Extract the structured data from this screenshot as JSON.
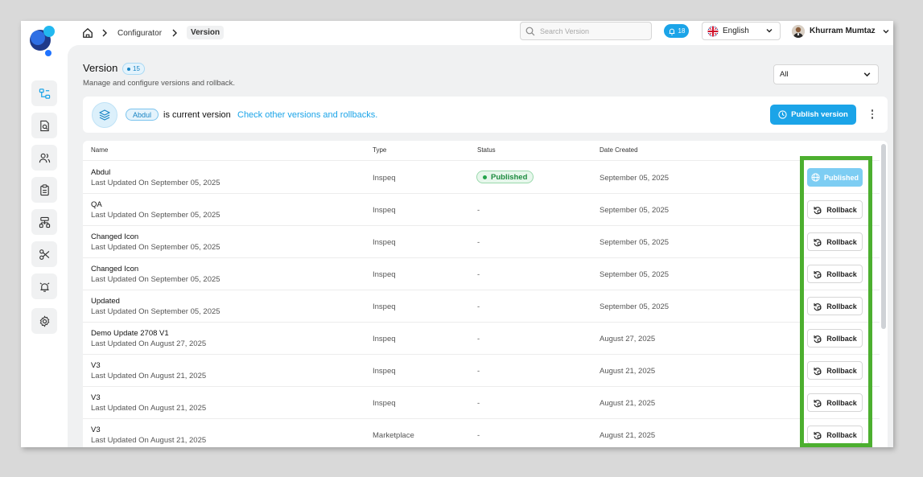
{
  "breadcrumb": {
    "root": "Configurator",
    "current": "Version"
  },
  "search": {
    "placeholder": "Search Version",
    "value": ""
  },
  "notifications": {
    "count": "18"
  },
  "language": {
    "selected": "English"
  },
  "user": {
    "name": "Khurram Mumtaz"
  },
  "sidebar": {
    "items": [
      {
        "icon": "workflow-icon"
      },
      {
        "icon": "document-search-icon"
      },
      {
        "icon": "users-icon"
      },
      {
        "icon": "clipboard-icon"
      },
      {
        "icon": "hierarchy-icon"
      },
      {
        "icon": "scissors-icon"
      },
      {
        "icon": "alarm-icon"
      },
      {
        "icon": "gear-icon"
      }
    ]
  },
  "page": {
    "title": "Version",
    "count": "15",
    "subtitle": "Manage and configure versions and rollback.",
    "filter": "All"
  },
  "banner": {
    "current_version": "Abdul",
    "text": "is current version",
    "link": "Check other versions and rollbacks.",
    "publish_label": "Publish version"
  },
  "table": {
    "headers": {
      "name": "Name",
      "type": "Type",
      "status": "Status",
      "date": "Date Created"
    },
    "rows": [
      {
        "name": "Abdul",
        "updated": "Last Updated On September 05, 2025",
        "type": "Inspeq",
        "status": "Published",
        "date": "September 05, 2025",
        "action": "Published"
      },
      {
        "name": "QA",
        "updated": "Last Updated On September 05, 2025",
        "type": "Inspeq",
        "status": "-",
        "date": "September 05, 2025",
        "action": "Rollback"
      },
      {
        "name": "Changed Icon",
        "updated": "Last Updated On September 05, 2025",
        "type": "Inspeq",
        "status": "-",
        "date": "September 05, 2025",
        "action": "Rollback"
      },
      {
        "name": "Changed Icon",
        "updated": "Last Updated On September 05, 2025",
        "type": "Inspeq",
        "status": "-",
        "date": "September 05, 2025",
        "action": "Rollback"
      },
      {
        "name": "Updated",
        "updated": "Last Updated On September 05, 2025",
        "type": "Inspeq",
        "status": "-",
        "date": "September 05, 2025",
        "action": "Rollback"
      },
      {
        "name": "Demo Update 2708 V1",
        "updated": "Last Updated On August 27, 2025",
        "type": "Inspeq",
        "status": "-",
        "date": "August 27, 2025",
        "action": "Rollback"
      },
      {
        "name": "V3",
        "updated": "Last Updated On August 21, 2025",
        "type": "Inspeq",
        "status": "-",
        "date": "August 21, 2025",
        "action": "Rollback"
      },
      {
        "name": "V3",
        "updated": "Last Updated On August 21, 2025",
        "type": "Inspeq",
        "status": "-",
        "date": "August 21, 2025",
        "action": "Rollback"
      },
      {
        "name": "V3",
        "updated": "Last Updated On August 21, 2025",
        "type": "Marketplace",
        "status": "-",
        "date": "August 21, 2025",
        "action": "Rollback"
      }
    ]
  },
  "colors": {
    "accent": "#1ba4e8",
    "highlight": "#4caf2f",
    "published_green": "#1d8b3f"
  }
}
